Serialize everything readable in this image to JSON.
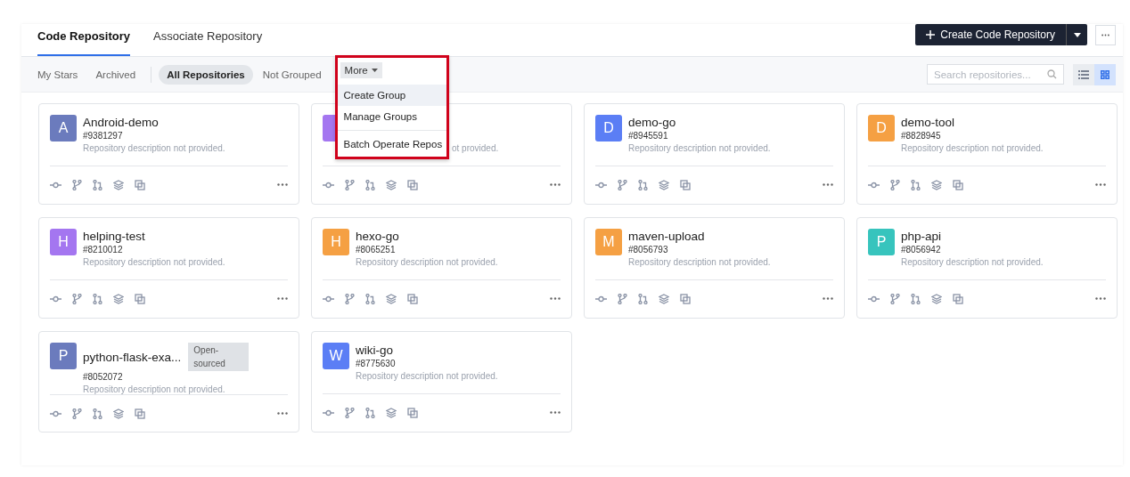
{
  "tabs": [
    {
      "label": "Code Repository",
      "selected": true
    },
    {
      "label": "Associate Repository",
      "selected": false
    }
  ],
  "create_button": {
    "label": "Create Code Repository"
  },
  "filters": [
    {
      "label": "My Stars",
      "selected": false
    },
    {
      "label": "Archived",
      "selected": false
    },
    {
      "label": "All Repositories",
      "selected": true
    },
    {
      "label": "Not Grouped",
      "selected": false
    }
  ],
  "more_menu": {
    "label": "More",
    "expanded": true,
    "items": [
      {
        "label": "Create Group",
        "selected": true
      },
      {
        "label": "Manage Groups",
        "selected": false
      },
      {
        "label": "Batch Operate Repos",
        "selected": false
      }
    ]
  },
  "search": {
    "placeholder": "Search repositories..."
  },
  "view_toggle": [
    {
      "kind": "list",
      "selected": false
    },
    {
      "kind": "grid",
      "selected": true
    }
  ],
  "repositories": [
    {
      "avatar": "A",
      "color": "#6b7bbd",
      "name": "Android-demo",
      "id": "#9381297",
      "description": "Repository description not provided."
    },
    {
      "color": "#a476f0",
      "description": "ot provided.",
      "covered": true
    },
    {
      "avatar": "D",
      "color": "#5b7ef5",
      "name": "demo-go",
      "id": "#8945591",
      "description": "Repository description not provided."
    },
    {
      "avatar": "D",
      "color": "#f5a043",
      "name": "demo-tool",
      "id": "#8828945",
      "description": "Repository description not provided."
    },
    {
      "avatar": "H",
      "color": "#a476f0",
      "name": "helping-test",
      "id": "#8210012",
      "description": "Repository description not provided."
    },
    {
      "avatar": "H",
      "color": "#f5a043",
      "name": "hexo-go",
      "id": "#8065251",
      "description": "Repository description not provided."
    },
    {
      "avatar": "M",
      "color": "#f5a043",
      "name": "maven-upload",
      "id": "#8056793",
      "description": "Repository description not provided."
    },
    {
      "avatar": "P",
      "color": "#37c4bd",
      "name": "php-api",
      "id": "#8056942",
      "description": "Repository description not provided."
    },
    {
      "avatar": "P",
      "color": "#6b7bbd",
      "name": "python-flask-exa...",
      "badge": "Open-sourced",
      "id": "#8052072",
      "description": "Repository description not provided."
    },
    {
      "avatar": "W",
      "color": "#5b7ef5",
      "name": "wiki-go",
      "id": "#8775630",
      "description": "Repository description not provided."
    }
  ]
}
